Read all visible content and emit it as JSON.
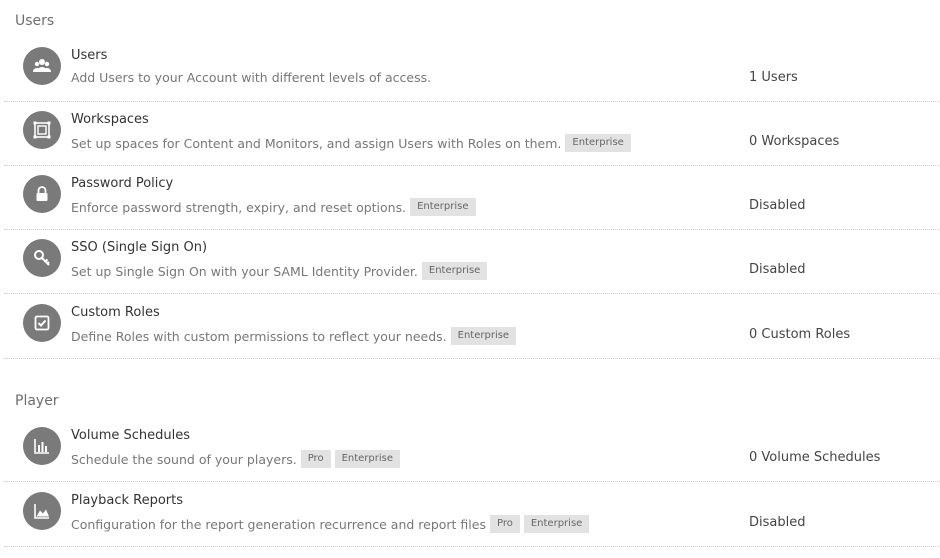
{
  "sections": {
    "users": {
      "title": "Users"
    },
    "player": {
      "title": "Player"
    }
  },
  "rows": [
    {
      "icon": "users-icon",
      "title": "Users",
      "description": "Add Users to your Account with different levels of access.",
      "badges": [],
      "value": "1 Users"
    },
    {
      "icon": "workspaces-icon",
      "title": "Workspaces",
      "description": "Set up spaces for Content and Monitors, and assign Users with Roles on them.",
      "badges": [
        "Enterprise"
      ],
      "value": "0 Workspaces"
    },
    {
      "icon": "lock-icon",
      "title": "Password Policy",
      "description": "Enforce password strength, expiry, and reset options.",
      "badges": [
        "Enterprise"
      ],
      "value": "Disabled"
    },
    {
      "icon": "key-icon",
      "title": "SSO (Single Sign On)",
      "description": "Set up Single Sign On with your SAML Identity Provider.",
      "badges": [
        "Enterprise"
      ],
      "value": "Disabled"
    },
    {
      "icon": "checkbox-icon",
      "title": "Custom Roles",
      "description": "Define Roles with custom permissions to reflect your needs.",
      "badges": [
        "Enterprise"
      ],
      "value": "0 Custom Roles"
    },
    {
      "icon": "bar-chart-icon",
      "title": "Volume Schedules",
      "description": "Schedule the sound of your players.",
      "badges": [
        "Pro",
        "Enterprise"
      ],
      "value": "0 Volume Schedules"
    },
    {
      "icon": "area-chart-icon",
      "title": "Playback Reports",
      "description": "Configuration for the report generation recurrence and report files",
      "badges": [
        "Pro",
        "Enterprise"
      ],
      "value": "Disabled"
    }
  ]
}
